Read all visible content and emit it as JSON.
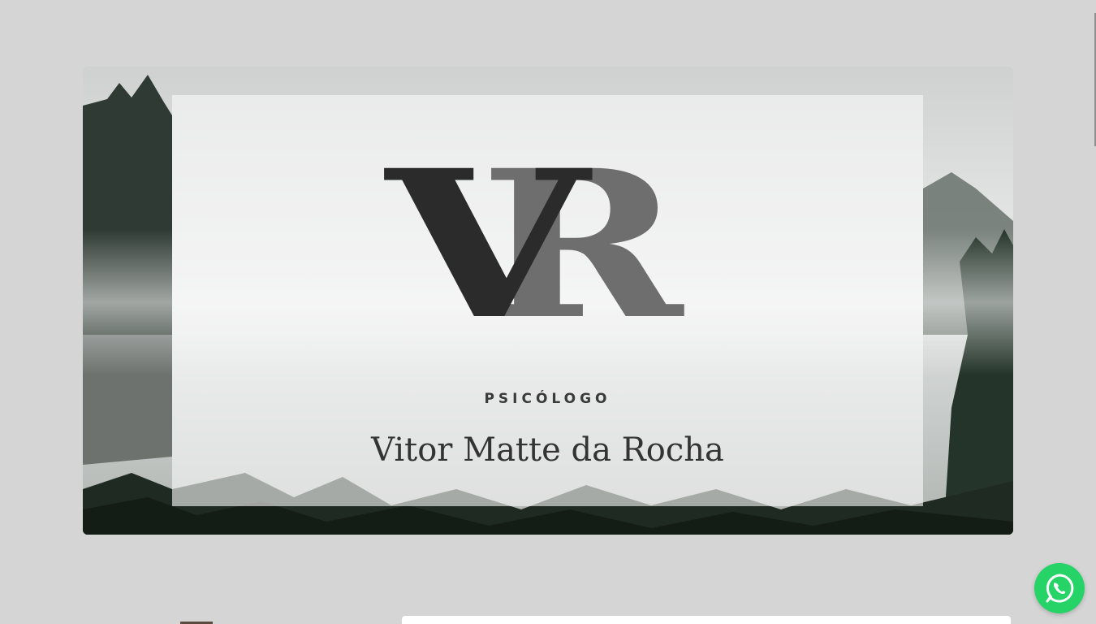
{
  "hero": {
    "logo_text": "VR",
    "subtitle": "PSICÓLOGO",
    "name": "Vitor Matte da Rocha"
  },
  "icons": {
    "whatsapp": "whatsapp-icon"
  },
  "colors": {
    "page_background": "#d5d5d5",
    "whatsapp": "#25d366",
    "text": "#333333",
    "logo_dark": "#2b2b2b",
    "logo_gray": "#6e6e6e"
  }
}
